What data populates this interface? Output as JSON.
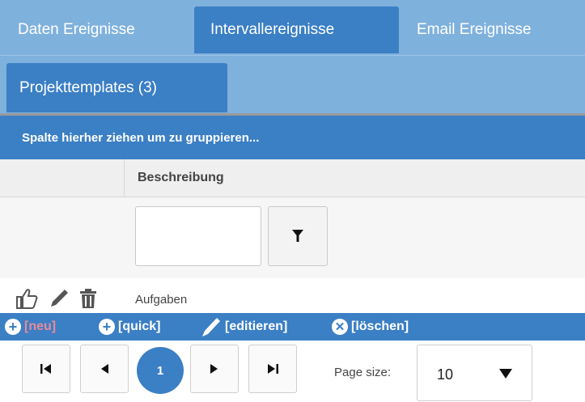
{
  "tabs_top": [
    {
      "label": "Daten Ereignisse",
      "active": false
    },
    {
      "label": "Intervallereignisse",
      "active": true
    },
    {
      "label": "Email Ereignisse",
      "active": false
    }
  ],
  "tabs_second": {
    "label": "Projekttemplates (3)"
  },
  "group_bar": {
    "text": "Spalte hierher ziehen um zu gruppieren..."
  },
  "grid": {
    "column_header": "Beschreibung",
    "filter_value": "",
    "row": {
      "text": "Aufgaben"
    }
  },
  "toolbar": {
    "neu": "[neu]",
    "quick": "[quick]",
    "edit": "[editieren]",
    "delete": "[löschen]"
  },
  "pager": {
    "current_page": "1",
    "page_size_label": "Page size:",
    "page_size_value": "10"
  },
  "colors": {
    "tab_bar": "#7fb1dd",
    "accent": "#3b7fc5",
    "neu_disabled": "#e98a9a"
  }
}
